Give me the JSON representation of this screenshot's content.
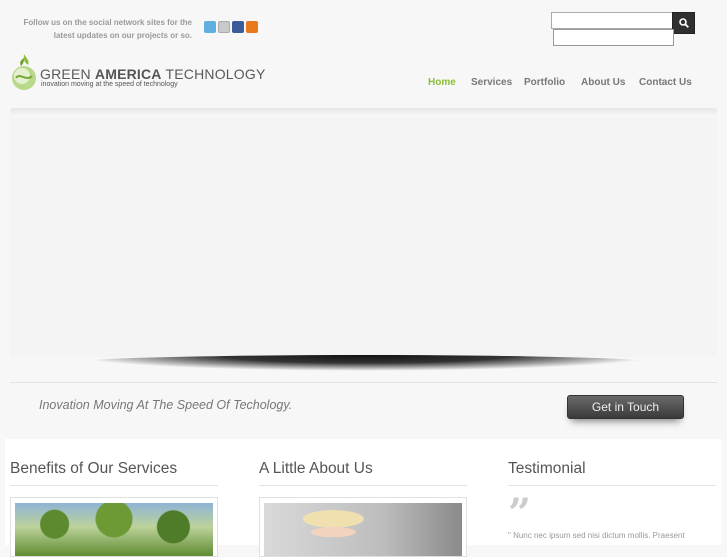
{
  "header": {
    "follow_text": "Follow us on the social network sites for the latest updates on our projects or so.",
    "social_icons": [
      "twitter-icon",
      "mail-icon",
      "facebook-icon",
      "rss-icon"
    ]
  },
  "search": {
    "placeholder": "",
    "value": ""
  },
  "logo": {
    "title_first": "GREEN",
    "title_bold": "AMERICA",
    "title_last": "TECHNOLOGY",
    "tagline": "inovation moving at the speed of technology"
  },
  "nav": {
    "items": [
      {
        "label": "Home",
        "active": true
      },
      {
        "label": "Services",
        "active": false
      },
      {
        "label": "Portfolio",
        "active": false
      },
      {
        "label": "About Us",
        "active": false
      },
      {
        "label": "Contact Us",
        "active": false
      }
    ],
    "active_color": "#8bbf3b"
  },
  "banner": {
    "tagline": "Inovation Moving At The Speed Of Techology.",
    "cta_label": "Get in Touch"
  },
  "columns": {
    "benefits_title": "Benefits of Our Services",
    "about_title": "A Little About Us",
    "testimonial_title": "Testimonial",
    "testimonial_text": "\" Nunc nec ipsum sed nisi dictum mollis. Praesent"
  }
}
